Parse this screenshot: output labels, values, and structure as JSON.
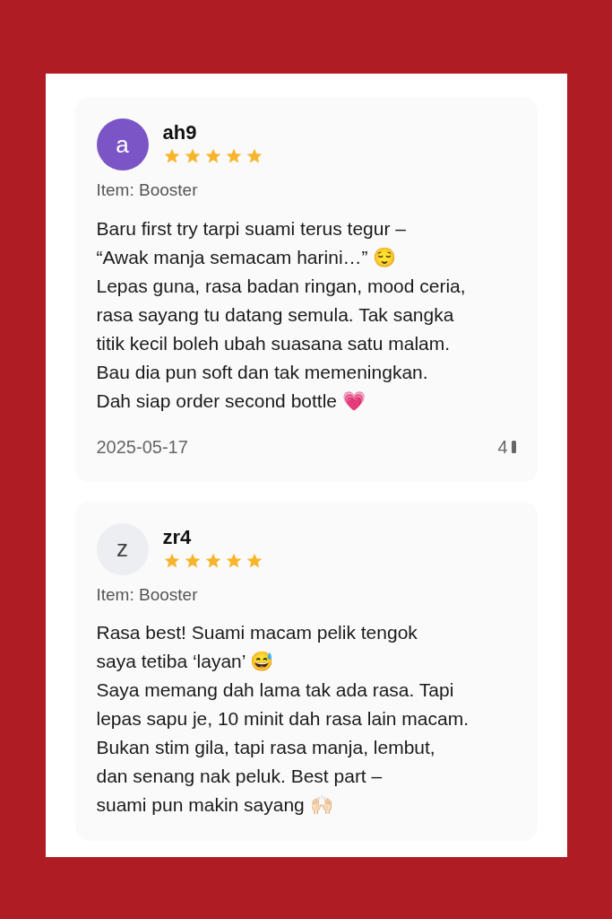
{
  "reviews": [
    {
      "avatar": {
        "letter": "a",
        "color": "#7b55c6"
      },
      "username": "ah9",
      "stars": 5,
      "item": "Item: Booster",
      "lines": [
        "Baru first try tarpi suami terus tegur –",
        "“Awak manja semacam harini…” 😌",
        "Lepas guna, rasa badan ringan, mood ceria,",
        "rasa sayang tu datang semula. Tak sangka",
        "titik kecil boleh ubah suasana satu malam.",
        "Bau dia pun soft dan tak memeningkan.",
        "Dah siap order second bottle 💗"
      ],
      "date": "2025-05-17",
      "likes": "4"
    },
    {
      "avatar": {
        "letter": "z",
        "color": "#eceef1"
      },
      "username": "zr4",
      "stars": 5,
      "item": "Item: Booster",
      "lines": [
        "Rasa best! Suami macam pelik tengok",
        "saya tetiba ‘layan’ 😅",
        "Saya memang dah lama tak ada rasa. Tapi",
        "lepas sapu je, 10 minit dah rasa lain macam.",
        "Bukan stim gila, tapi rasa manja, lembut,",
        "dan senang nak peluk. Best part –",
        "suami pun makin sayang 🙌🏻"
      ]
    }
  ]
}
